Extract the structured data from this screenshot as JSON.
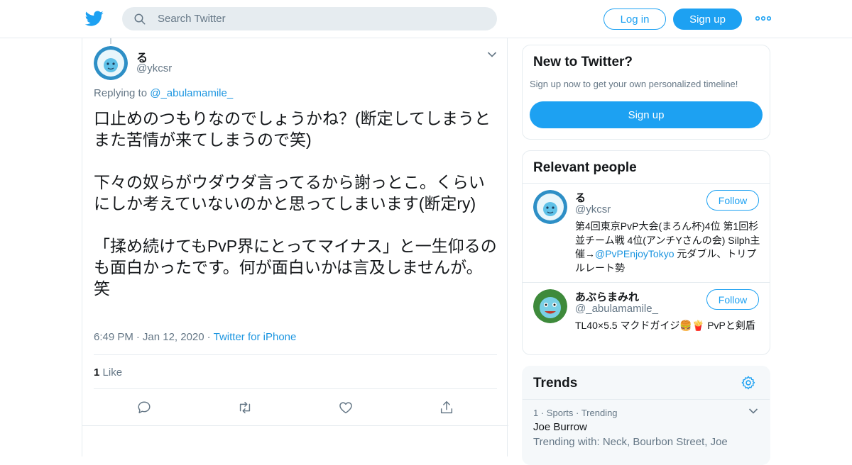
{
  "nav": {
    "search_placeholder": "Search Twitter",
    "login_label": "Log in",
    "signup_label": "Sign up"
  },
  "tweet": {
    "author_name": "る",
    "author_handle": "@ykcsr",
    "replying_prefix": "Replying to ",
    "replying_to": "@_abulamamile_",
    "text": "口止めのつもりなのでしょうかね？(断定してしまうとまた苦情が来てしまうので笑)\n\n下々の奴らがウダウダ言ってるから謝っとこ。くらいにしか考えていないのかと思ってしまいます(断定ry)\n\n「揉め続けてもPvP界にとってマイナス」と一生仰るのも面白かったです。何が面白いかは言及しませんが。笑",
    "time": "6:49 PM",
    "date": "Jan 12, 2020",
    "source": "Twitter for iPhone",
    "like_count": "1",
    "like_label": "Like"
  },
  "new_to_twitter": {
    "title": "New to Twitter?",
    "subtitle": "Sign up now to get your own personalized timeline!",
    "signup_label": "Sign up"
  },
  "relevant_people": {
    "title": "Relevant people",
    "people": [
      {
        "name": "る",
        "handle": "@ykcsr",
        "follow_label": "Follow",
        "bio_pre": "第4回東京PvP大会(まろん杯)4位 第1回杉並チーム戦 4位(アンチYさんの会) Silph主催→",
        "bio_link": "@PvPEnjoyTokyo",
        "bio_post": " 元ダブル、トリプルレート勢"
      },
      {
        "name": "あぶらまみれ",
        "handle": "@_abulamamile_",
        "follow_label": "Follow",
        "bio_pre": "TL40×5.5 マクドガイジ🍔🍟 PvPと剣盾",
        "bio_link": "",
        "bio_post": ""
      }
    ]
  },
  "trends": {
    "title": "Trends",
    "item": {
      "rank": "1",
      "category": "Sports",
      "status": "Trending",
      "name": "Joe Burrow",
      "with": "Trending with: Neck, Bourbon Street, Joe"
    }
  },
  "colors": {
    "accent": "#1da1f2",
    "link": "#1b95e0",
    "muted": "#657786",
    "border": "#e6ecf0"
  }
}
